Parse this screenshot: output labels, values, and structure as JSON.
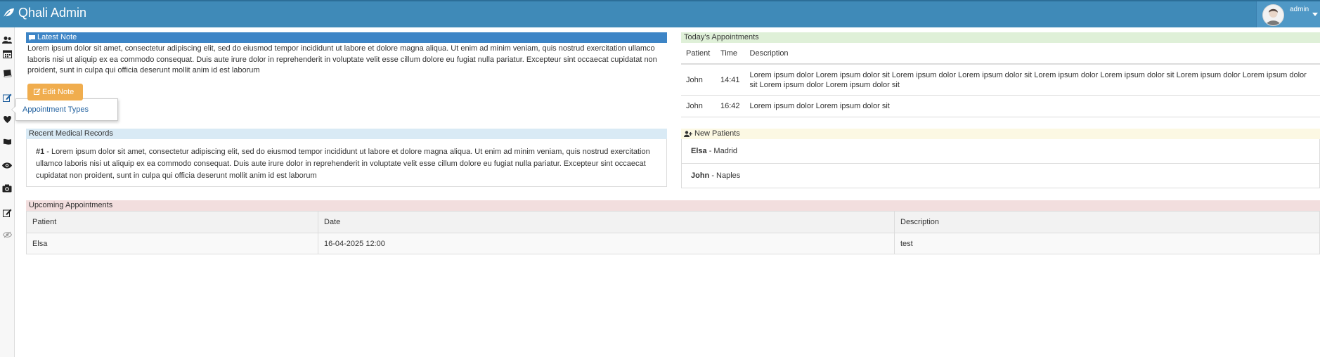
{
  "app": {
    "title": "Qhali Admin"
  },
  "user": {
    "name": "admin"
  },
  "sidebar": {
    "icons": [
      "users-icon",
      "calendar-icon",
      "book-icon",
      "edit-icon",
      "heart-icon",
      "flag-icon",
      "eye-icon",
      "camera-icon",
      "pencil-icon",
      "eye-slash-icon"
    ],
    "flyout_label": "Appointment Types"
  },
  "latest_note": {
    "title": "Latest Note",
    "text": "Lorem ipsum dolor sit amet, consectetur adipiscing elit, sed do eiusmod tempor incididunt ut labore et dolore magna aliqua. Ut enim ad minim veniam, quis nostrud exercitation ullamco laboris nisi ut aliquip ex ea commodo consequat. Duis aute irure dolor in reprehenderit in voluptate velit esse cillum dolore eu fugiat nulla pariatur. Excepteur sint occaecat cupidatat non proident, sunt in culpa qui officia deserunt mollit anim id est laborum",
    "edit_label": "Edit Note"
  },
  "today": {
    "title": "Today's Appointments",
    "columns": [
      "Patient",
      "Time",
      "Description"
    ],
    "rows": [
      {
        "patient": "John",
        "time": "14:41",
        "description": "Lorem ipsum dolor Lorem ipsum dolor sit Lorem ipsum dolor Lorem ipsum dolor sit Lorem ipsum dolor Lorem ipsum dolor sit Lorem ipsum dolor Lorem ipsum dolor sit Lorem ipsum dolor Lorem ipsum dolor sit"
      },
      {
        "patient": "John",
        "time": "16:42",
        "description": "Lorem ipsum dolor Lorem ipsum dolor sit"
      }
    ]
  },
  "records": {
    "title": "Recent Medical Records",
    "items": [
      {
        "num": "#1",
        "text": " - Lorem ipsum dolor sit amet, consectetur adipiscing elit, sed do eiusmod tempor incididunt ut labore et dolore magna aliqua. Ut enim ad minim veniam, quis nostrud exercitation ullamco laboris nisi ut aliquip ex ea commodo consequat. Duis aute irure dolor in reprehenderit in voluptate velit esse cillum dolore eu fugiat nulla pariatur. Excepteur sint occaecat cupidatat non proident, sunt in culpa qui officia deserunt mollit anim id est laborum"
      }
    ]
  },
  "new_patients": {
    "title": "New Patients",
    "items": [
      {
        "name": "Elsa",
        "city": " - Madrid"
      },
      {
        "name": "John",
        "city": " - Naples"
      }
    ]
  },
  "upcoming": {
    "title": "Upcoming Appointments",
    "columns": [
      "Patient",
      "Date",
      "Description"
    ],
    "rows": [
      {
        "patient": "Elsa",
        "date": "16-04-2025 12:00",
        "description": "test"
      }
    ]
  },
  "colors": {
    "navbar": "#3f8ab8",
    "note_heading": "#3d85c6",
    "today_heading": "#dff0d8",
    "records_heading": "#d9eaf5",
    "new_patients_heading": "#fcf8e3",
    "upcoming_heading": "#f2dede",
    "edit_button": "#f0ad4e"
  }
}
